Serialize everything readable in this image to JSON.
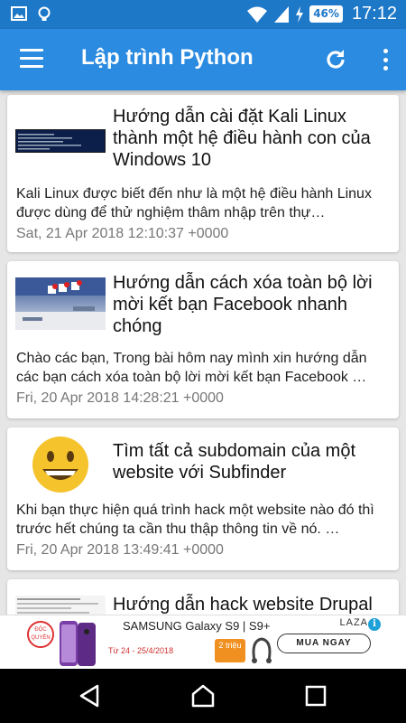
{
  "status_bar": {
    "time": "17:12",
    "battery": "46%"
  },
  "app_bar": {
    "title": "Lập trình Python"
  },
  "articles": [
    {
      "title": "Hướng dẫn cài đặt Kali Linux thành một hệ điều hành con của Windows 10",
      "excerpt": "Kali Linux được biết đến như là một hệ điều hành Linux được dùng để thử nghiệm thâm nhập trên thự…",
      "date": "Sat, 21 Apr 2018 12:10:37 +0000",
      "thumbnail": "terminal-screenshot"
    },
    {
      "title": "Hướng dẫn cách xóa toàn bộ lời mời kết bạn Facebook nhanh chóng",
      "excerpt": "Chào các bạn, Trong bài hôm nay mình xin hướng dẫn các bạn cách xóa toàn bộ lời mời kết bạn Facebook …",
      "date": "Fri, 20 Apr 2018 14:28:21 +0000",
      "thumbnail": "facebook-screenshot"
    },
    {
      "title": "Tìm tất cả subdomain của một website với Subfinder",
      "excerpt": "Khi bạn thực hiện quá trình hack một website nào đó thì trước hết chúng ta cần thu thập thông tin về nó. …",
      "date": "Fri, 20 Apr 2018 13:49:41 +0000",
      "thumbnail": "smiley-emoji"
    },
    {
      "title": "Hướng dẫn hack website Drupal",
      "thumbnail": "drupal-screenshot"
    }
  ],
  "ad": {
    "badge": "ĐỘC QUYỀN",
    "brand": "SAMSUNG Galaxy S9 | S9+",
    "dates": "Từ 24 - 25/4/2018",
    "promo": "2 triệu",
    "cta": "MUA NGAY",
    "advertiser": "LAZA",
    "info_icon": "info-icon"
  },
  "colors": {
    "status_bar": "#1e78c8",
    "app_bar": "#2b8be0",
    "background": "#e6e6e6"
  }
}
